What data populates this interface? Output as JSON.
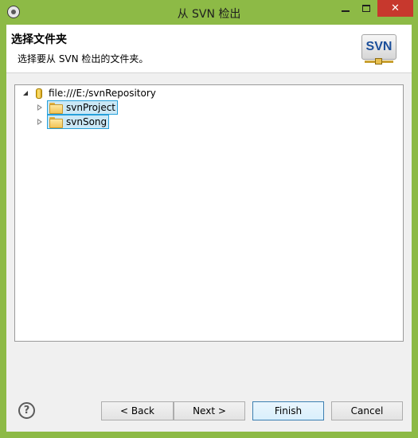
{
  "window": {
    "title": "从 SVN 检出",
    "close_glyph": "✕",
    "colors": {
      "frame": "#8dba46",
      "close": "#c7382d",
      "selection_bg": "#cbe8f6",
      "selection_border": "#26a0da"
    }
  },
  "header": {
    "title": "选择文件夹",
    "description": "选择要从 SVN 检出的文件夹。",
    "logo_text": "SVN"
  },
  "tree": {
    "root": {
      "label": "file:///E:/svnRepository",
      "expanded": true,
      "icon": "repository-icon"
    },
    "children": [
      {
        "label": "svnProject",
        "icon": "folder-icon",
        "selected": true
      },
      {
        "label": "svnSong",
        "icon": "folder-icon",
        "selected": true
      }
    ]
  },
  "footer": {
    "help_glyph": "?",
    "back_label": "< Back",
    "next_label": "Next >",
    "finish_label": "Finish",
    "cancel_label": "Cancel"
  }
}
